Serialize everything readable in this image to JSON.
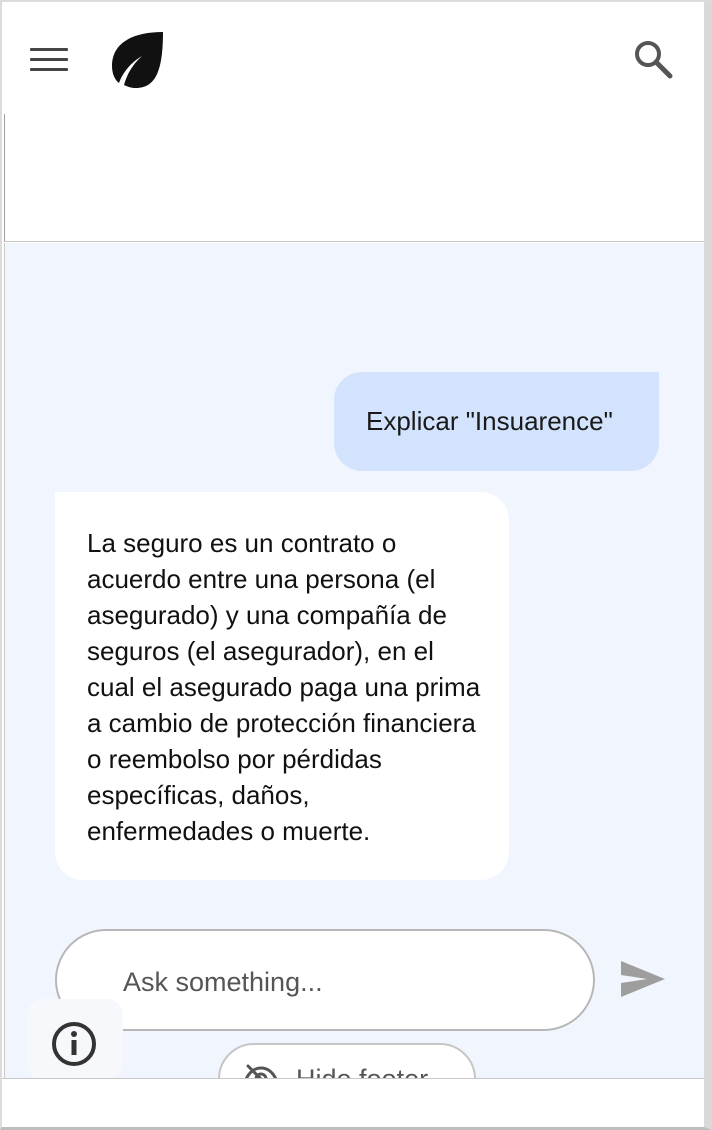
{
  "header": {
    "menu_icon": "hamburger-menu-icon",
    "logo_icon": "leaf-logo-icon",
    "search_icon": "search-icon"
  },
  "chat": {
    "messages": [
      {
        "role": "user",
        "text": "Explicar \"Insuarence\""
      },
      {
        "role": "assistant",
        "text": "La seguro es un contrato o acuerdo entre una persona (el asegurado) y una compañía de seguros (el asegurador), en el cual el asegurado paga una prima a cambio de protección financiera o reembolso por pérdidas específicas, daños, enfermedades o muerte."
      }
    ],
    "user_bubble_color": "#d3e3fd",
    "background_color": "#f1f5fd"
  },
  "composer": {
    "placeholder": "Ask something...",
    "value": "",
    "send_icon": "send-icon"
  },
  "info": {
    "icon": "info-icon"
  },
  "footer_toggle": {
    "label": "Hide footer",
    "icon": "eye-off-icon"
  }
}
